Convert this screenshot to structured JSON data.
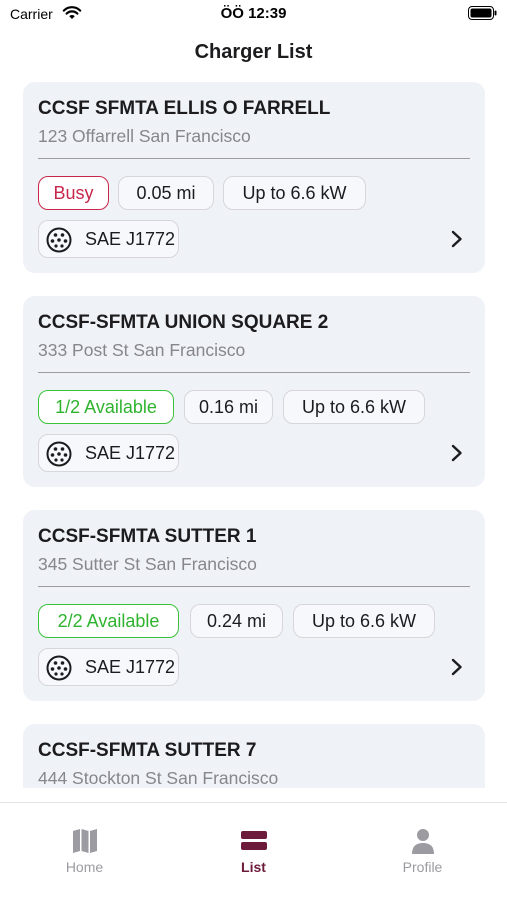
{
  "status_bar": {
    "carrier": "Carrier",
    "time": "ÖÖ 12:39"
  },
  "page": {
    "title": "Charger List"
  },
  "chargers": [
    {
      "name": "CCSF SFMTA ELLIS O FARRELL",
      "address": "123 Offarrell San Francisco",
      "status": "Busy",
      "distance": "0.05 mi",
      "power": "Up to 6.6 kW",
      "connector": "SAE J1772"
    },
    {
      "name": "CCSF-SFMTA UNION SQUARE 2",
      "address": "333 Post St San Francisco",
      "status": "1/2 Available",
      "distance": "0.16 mi",
      "power": "Up to 6.6 kW",
      "connector": "SAE J1772"
    },
    {
      "name": "CCSF-SFMTA SUTTER 1",
      "address": "345 Sutter St San Francisco",
      "status": "2/2 Available",
      "distance": "0.24 mi",
      "power": "Up to 6.6 kW",
      "connector": "SAE J1772"
    },
    {
      "name": "CCSF-SFMTA SUTTER 7",
      "address": "444 Stockton St San Francisco"
    }
  ],
  "tabs": [
    {
      "label": "Home",
      "icon": "map-icon"
    },
    {
      "label": "List",
      "icon": "list-icon"
    },
    {
      "label": "Profile",
      "icon": "person-icon"
    }
  ],
  "colors": {
    "busy": "#c8274c",
    "available": "#3ac33a",
    "accent": "#6d1b3b",
    "card_bg": "#eff2f7"
  }
}
